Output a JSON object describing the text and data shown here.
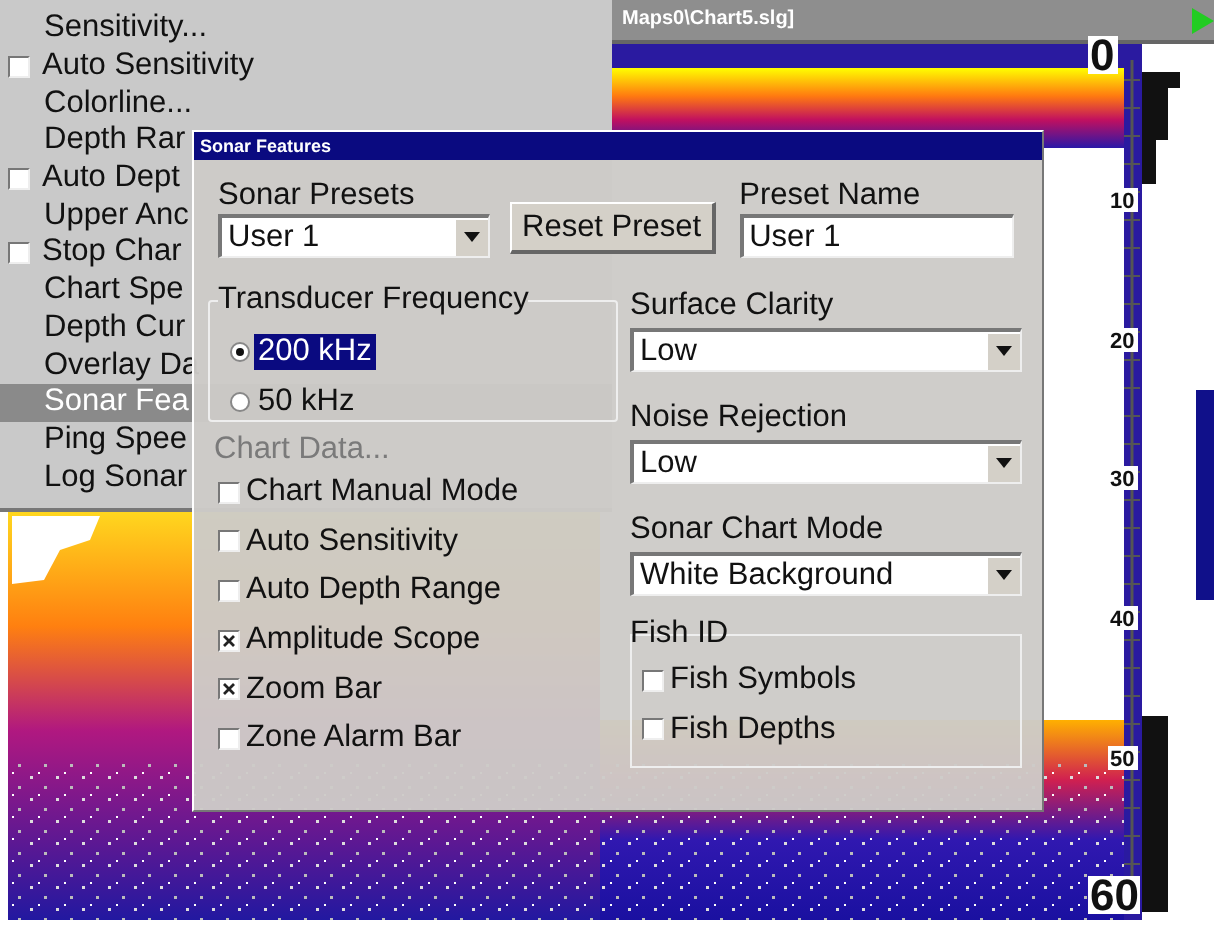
{
  "title_bar": {
    "text": "Maps0\\Chart5.slg]"
  },
  "depth_scale": {
    "labels": [
      "0",
      "10",
      "20",
      "30",
      "40",
      "50",
      "60"
    ]
  },
  "menu": {
    "items": [
      {
        "label": "Sensitivity...",
        "kind": "plain",
        "selected": false
      },
      {
        "label": "Auto Sensitivity",
        "kind": "check",
        "checked": false,
        "selected": false
      },
      {
        "label": "Colorline...",
        "kind": "plain",
        "selected": false
      },
      {
        "label": "Depth Rar",
        "kind": "plain",
        "selected": false
      },
      {
        "label": "Auto Dept",
        "kind": "check",
        "checked": false,
        "selected": false
      },
      {
        "label": "Upper Anc",
        "kind": "plain",
        "selected": false
      },
      {
        "label": "Stop Char",
        "kind": "check",
        "checked": false,
        "selected": false
      },
      {
        "label": "Chart Spe",
        "kind": "plain",
        "selected": false
      },
      {
        "label": "Depth Cur",
        "kind": "plain",
        "selected": false
      },
      {
        "label": "Overlay Da",
        "kind": "plain",
        "selected": false
      },
      {
        "label": "Sonar Fea",
        "kind": "plain",
        "selected": true
      },
      {
        "label": "Ping Spee",
        "kind": "plain",
        "selected": false
      },
      {
        "label": "Log Sonar",
        "kind": "plain",
        "selected": false
      }
    ],
    "ghost_text": "Chart Data..."
  },
  "dialog": {
    "title": "Sonar Features",
    "presets": {
      "label": "Sonar Presets",
      "value": "User 1"
    },
    "reset_button": "Reset Preset",
    "preset_name": {
      "label": "Preset Name",
      "value": "User 1"
    },
    "frequency": {
      "label": "Transducer Frequency",
      "options": [
        {
          "label": "200 kHz",
          "selected": true
        },
        {
          "label": "50 kHz",
          "selected": false
        }
      ]
    },
    "checkboxes": [
      {
        "label": "Chart Manual Mode",
        "checked": false
      },
      {
        "label": "Auto Sensitivity",
        "checked": false
      },
      {
        "label": "Auto Depth Range",
        "checked": false
      },
      {
        "label": "Amplitude Scope",
        "checked": true
      },
      {
        "label": "Zoom Bar",
        "checked": true
      },
      {
        "label": "Zone Alarm Bar",
        "checked": false
      }
    ],
    "selects": [
      {
        "label": "Surface Clarity",
        "value": "Low"
      },
      {
        "label": "Noise Rejection",
        "value": "Low"
      },
      {
        "label": "Sonar Chart Mode",
        "value": "White Background"
      }
    ],
    "fish_id": {
      "label": "Fish ID",
      "options": [
        {
          "label": "Fish Symbols",
          "checked": false
        },
        {
          "label": "Fish Depths",
          "checked": false
        }
      ]
    }
  }
}
